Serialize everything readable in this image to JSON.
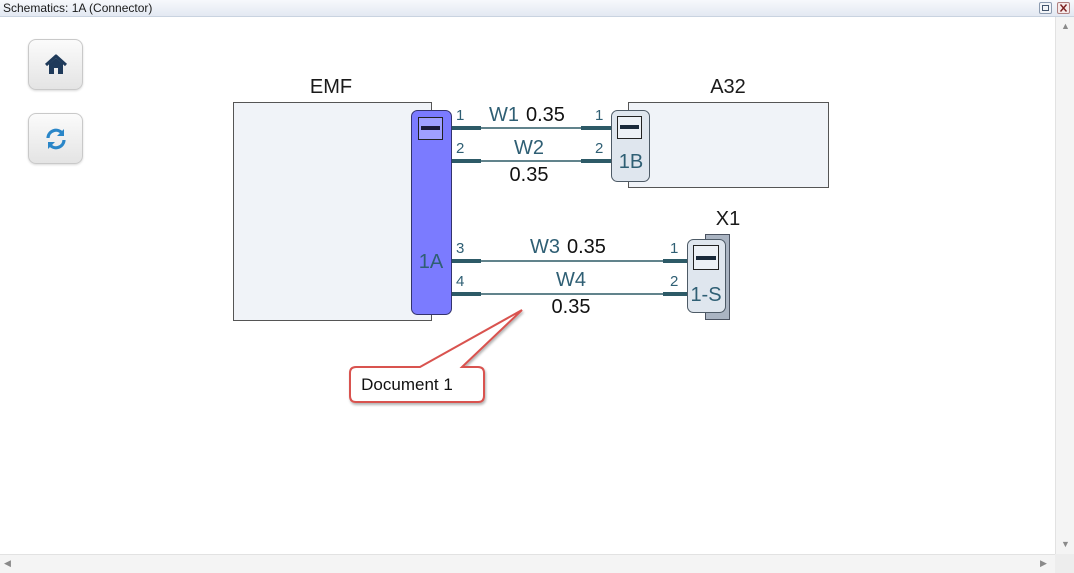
{
  "window": {
    "title": "Schematics: 1A (Connector)"
  },
  "toolbar": {
    "home_icon": "home-icon",
    "refresh_icon": "refresh-icon"
  },
  "diagram": {
    "components": {
      "emf": {
        "name": "EMF",
        "connector": "1A"
      },
      "a32": {
        "name": "A32",
        "connector": "1B"
      },
      "x1": {
        "name": "X1",
        "connector": "1-S"
      }
    },
    "wires": [
      {
        "id": "W1",
        "gauge": "0.35",
        "from_pin": "1",
        "to_pin": "1"
      },
      {
        "id": "W2",
        "gauge": "0.35",
        "from_pin": "2",
        "to_pin": "2"
      },
      {
        "id": "W3",
        "gauge": "0.35",
        "from_pin": "3",
        "to_pin": "1"
      },
      {
        "id": "W4",
        "gauge": "0.35",
        "from_pin": "4",
        "to_pin": "2"
      }
    ],
    "callout": {
      "text": "Document 1"
    }
  },
  "colors": {
    "connector_fill": "#7b7bff",
    "wire": "#2d5a67",
    "wire_label": "#2f5f74",
    "pin_label": "#2f5f74",
    "callout_border": "#d9534f"
  }
}
